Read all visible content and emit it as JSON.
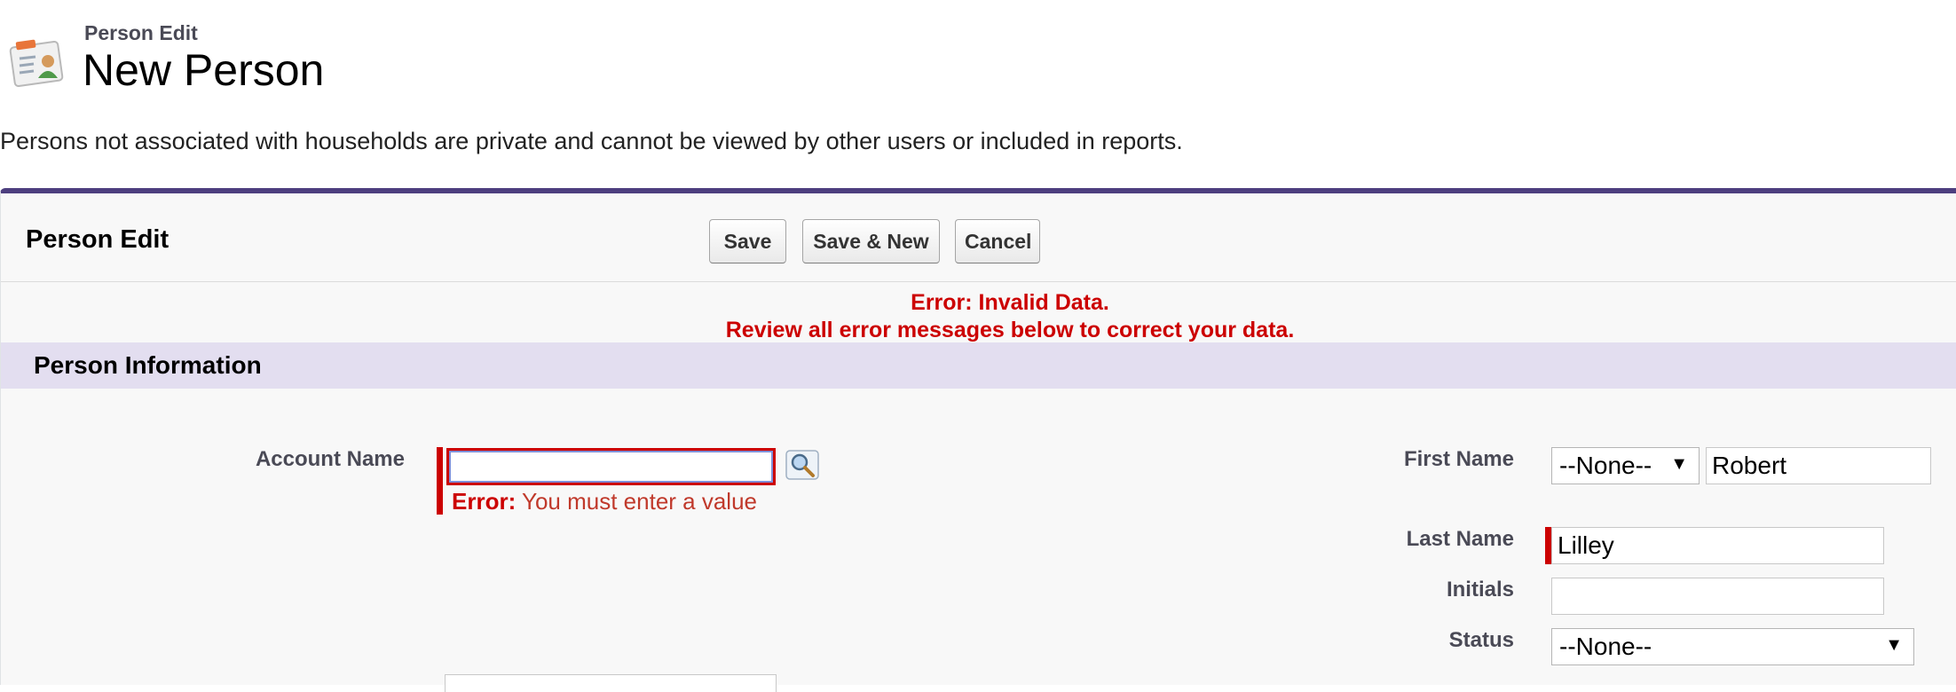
{
  "header": {
    "type_label": "Person Edit",
    "title": "New Person",
    "icon": "person-card-icon"
  },
  "notice": "Persons not associated with households are private and cannot be viewed by other users or included in reports.",
  "edit_block": {
    "title": "Person Edit",
    "buttons": {
      "save": "Save",
      "save_new": "Save & New",
      "cancel": "Cancel"
    },
    "page_error": {
      "line1": "Error: Invalid Data.",
      "line2": "Review all error messages below to correct your data."
    }
  },
  "section": {
    "title": "Person Information"
  },
  "fields": {
    "account_name": {
      "label": "Account Name",
      "value": "",
      "error_prefix": "Error:",
      "error_text": "You must enter a value",
      "lookup_icon": "magnifier-lookup-icon"
    },
    "first_name": {
      "label": "First Name",
      "salutation": "--None--",
      "value": "Robert"
    },
    "last_name": {
      "label": "Last Name",
      "value": "Lilley"
    },
    "initials": {
      "label": "Initials",
      "value": ""
    },
    "status": {
      "label": "Status",
      "value": "--None--"
    }
  },
  "colors": {
    "accent": "#4d3f7f",
    "section_bg": "#e3def0",
    "error": "#cc0000"
  }
}
